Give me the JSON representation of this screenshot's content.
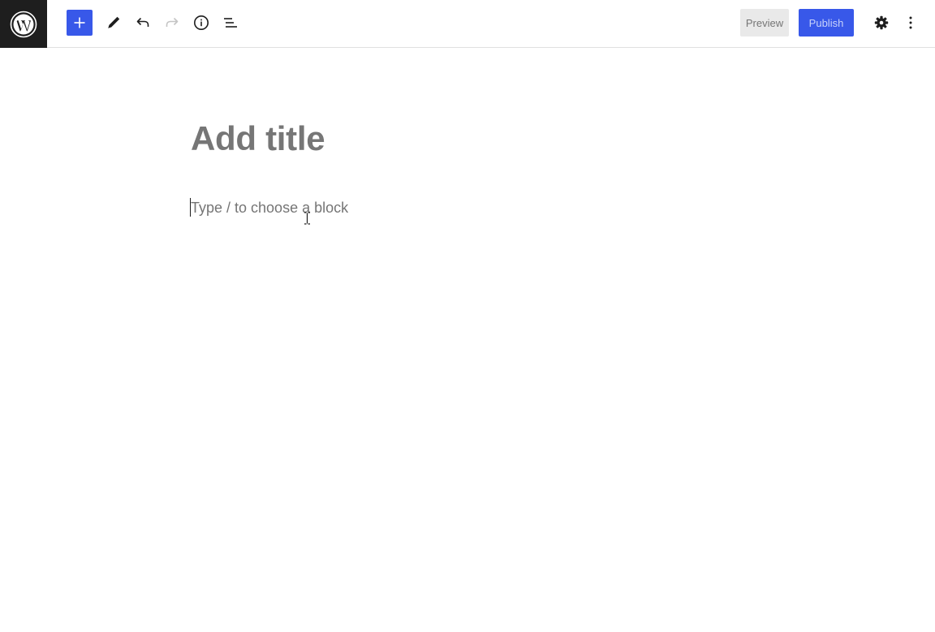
{
  "toolbar": {
    "logo_icon": "wordpress-logo-icon",
    "add_block_icon": "plus-icon",
    "tools_icon": "pencil-icon",
    "undo_icon": "undo-icon",
    "redo_icon": "redo-icon",
    "details_icon": "info-icon",
    "list_view_icon": "list-view-icon",
    "preview_label": "Preview",
    "publish_label": "Publish",
    "settings_icon": "gear-icon",
    "options_icon": "vertical-ellipsis-icon"
  },
  "editor": {
    "title_placeholder": "Add title",
    "block_placeholder": "Type / to choose a block"
  },
  "colors": {
    "accent": "#3858e9",
    "logo_bg": "#1e1e1e",
    "placeholder": "#757575"
  }
}
